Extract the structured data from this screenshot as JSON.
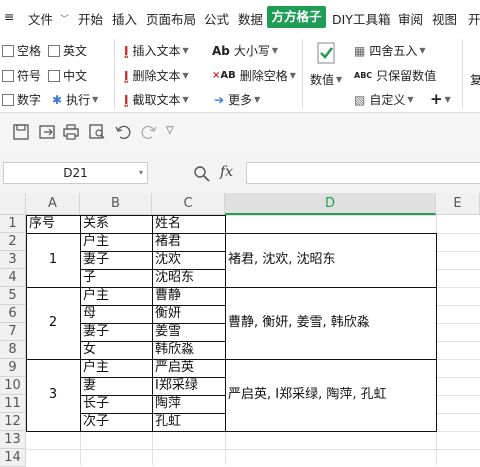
{
  "menu": {
    "file": "文件",
    "items": [
      "开始",
      "插入",
      "页面布局",
      "公式",
      "数据",
      "方方格子",
      "DIY工具箱",
      "审阅",
      "视图",
      "开"
    ],
    "active": "方方格子"
  },
  "ribbon": {
    "checkboxes": [
      "空格",
      "英文",
      "符号",
      "中文",
      "数字"
    ],
    "execute": "执行",
    "text_group": [
      "插入文本",
      "删除文本",
      "截取文本"
    ],
    "case_group": [
      "大小写",
      "删除空格",
      "更多"
    ],
    "number_label": "数值",
    "round_group": [
      "四舍五入",
      "只保留数值",
      "自定义"
    ],
    "plus": "+",
    "copy_label": "复"
  },
  "formula_bar": {
    "cell_ref": "D21",
    "fx": "fx",
    "value": ""
  },
  "sheet": {
    "columns": [
      "A",
      "B",
      "C",
      "D",
      "E"
    ],
    "selected_column": "D",
    "rows": [
      "1",
      "2",
      "3",
      "4",
      "5",
      "6",
      "7",
      "8",
      "9",
      "10",
      "11",
      "12",
      "13",
      "14"
    ],
    "header": [
      "序号",
      "关系",
      "姓名"
    ],
    "groups": [
      {
        "no": "1",
        "relations": [
          "户主",
          "妻子",
          "子"
        ],
        "names": [
          "褚君",
          "沈欢",
          "沈昭东"
        ],
        "merged": "褚君, 沈欢, 沈昭东"
      },
      {
        "no": "2",
        "relations": [
          "户主",
          "母",
          "妻子",
          "女"
        ],
        "names": [
          "曹静",
          "衡妍",
          "姜雪",
          "韩欣淼"
        ],
        "merged": "曹静, 衡妍, 姜雪, 韩欣淼"
      },
      {
        "no": "3",
        "relations": [
          "户主",
          "妻",
          "长子",
          "次子"
        ],
        "names": [
          "严启英",
          "I郑采绿",
          "陶萍",
          "孔虹"
        ],
        "merged": "严启英, I郑采绿, 陶萍, 孔虹"
      }
    ]
  }
}
